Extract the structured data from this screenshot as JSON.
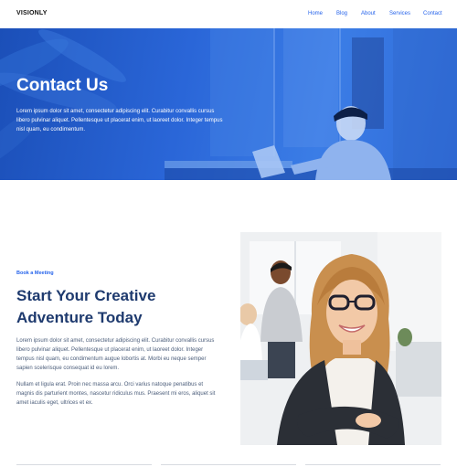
{
  "header": {
    "brand": "VISIONLY",
    "nav": [
      "Home",
      "Blog",
      "About",
      "Services",
      "Contact"
    ]
  },
  "hero": {
    "title": "Contact Us",
    "text": "Lorem ipsum dolor sit amet, consectetur adipiscing elit. Curabitur convallis cursus libero pulvinar aliquet. Pellentesque ut placerat enim, ut laoreet dolor. Integer tempus nisl quam, eu condimentum."
  },
  "section": {
    "kicker": "Book a Meeting",
    "heading": "Start Your Creative Adventure Today",
    "para1": "Lorem ipsum dolor sit amet, consectetur adipiscing elit. Curabitur convallis cursus libero pulvinar aliquet. Pellentesque ut placerat enim, ut laoreet dolor. Integer tempus nisl quam, eu condimentum augue lobortis at. Morbi eu neque semper sapien scelerisque consequat id eu lorem.",
    "para2": "Nullam et ligula erat. Proin nec massa arcu. Orci varius natoque penatibus et magnis dis parturient montes, nascetur ridiculus mus. Praesent mi eros, aliquet sit amet iaculis eget, ultrices et ex."
  },
  "colors": {
    "accent": "#2563eb",
    "heading": "#1e3a6e",
    "hero_overlay": "#2a66d8"
  }
}
